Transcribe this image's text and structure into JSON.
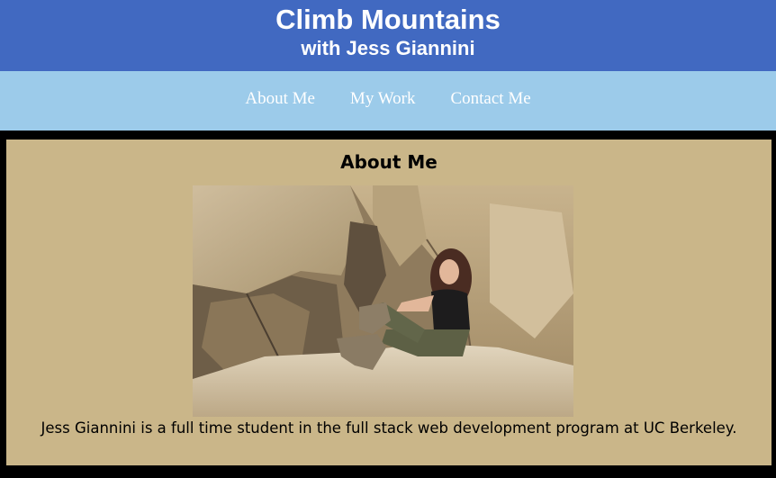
{
  "header": {
    "title": "Climb Mountains",
    "subtitle": "with Jess Giannini"
  },
  "nav": {
    "items": [
      {
        "label": "About Me"
      },
      {
        "label": "My Work"
      },
      {
        "label": "Contact Me"
      }
    ]
  },
  "about": {
    "heading": "About Me",
    "photo_icon": "profile-photo",
    "description": "Jess Giannini is a full time student in the full stack web development program at UC Berkeley."
  },
  "colors": {
    "header_bg": "#4169c1",
    "nav_bg": "#9ccbea",
    "section_bg": "#cab689",
    "page_bg": "#000000"
  }
}
